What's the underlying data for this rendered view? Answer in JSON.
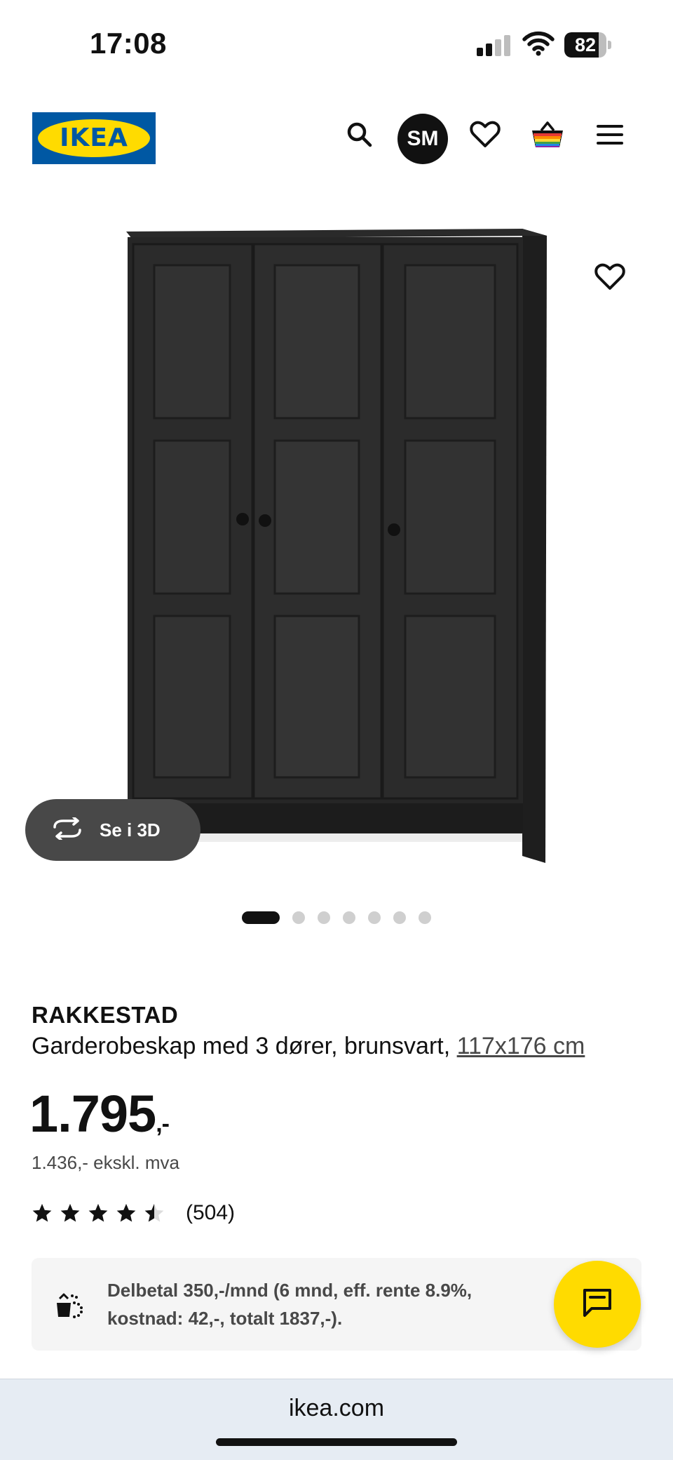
{
  "status_bar": {
    "time": "17:08",
    "battery_level": "82",
    "signal_bars": 2
  },
  "header": {
    "logo_text": "IKEA",
    "icons": [
      "search-icon",
      "heart-icon",
      "basket-icon",
      "menu-icon"
    ],
    "avatar_initials": "SM"
  },
  "gallery": {
    "see_3d_label": "Se i 3D",
    "total_images": 7,
    "active_index": 0
  },
  "product": {
    "name": "RAKKESTAD",
    "description": "Garderobeskap med 3 dører, brunsvart,",
    "size_link": "117x176 cm",
    "price_main": "1.795",
    "price_suffix": ",-",
    "price_ex_vat": "1.436,- ekskl. mva",
    "rating_value": 4.5,
    "rating_count": "(504)"
  },
  "finance": {
    "line1": "Delbetal 350,-/mnd (6 mnd, eff. rente 8.9%,",
    "line2": "kostnad: 42,-, totalt 1837,-)."
  },
  "browser": {
    "url": "ikea.com"
  },
  "colors": {
    "ikea_blue": "#0058a3",
    "ikea_yellow": "#ffdb00",
    "dark_gray": "#484848"
  }
}
